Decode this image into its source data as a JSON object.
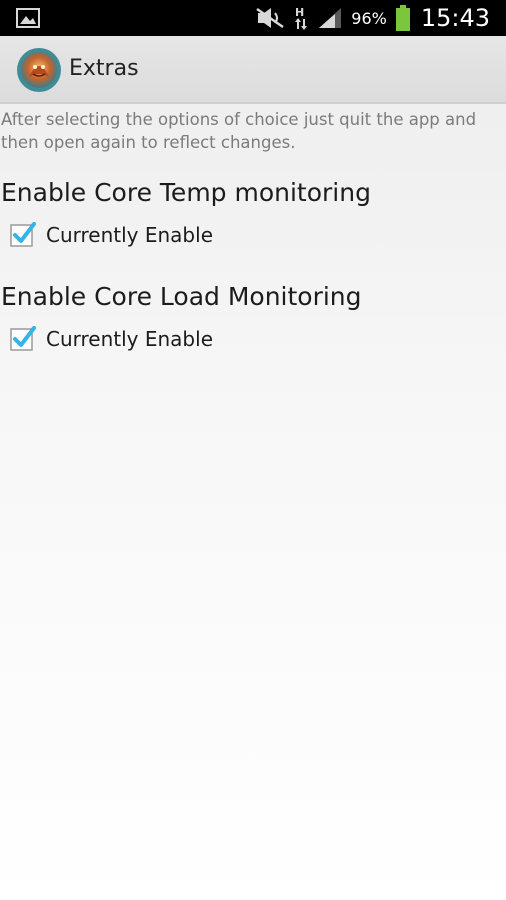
{
  "status_bar": {
    "battery_percent": "96%",
    "time": "15:43",
    "icons": [
      "image-notification-icon",
      "mute-icon",
      "network-hplus-icon",
      "signal-icon",
      "battery-icon"
    ]
  },
  "action_bar": {
    "title": "Extras",
    "icon": "app-logo-icon"
  },
  "content": {
    "instruction": "After selecting the options of choice just quit the app and then open again to reflect changes.",
    "sections": [
      {
        "title": "Enable Core Temp monitoring",
        "checkbox_label": "Currently Enable",
        "checked": true
      },
      {
        "title": "Enable Core Load Monitoring",
        "checkbox_label": "Currently Enable",
        "checked": true
      }
    ]
  },
  "colors": {
    "check_accent": "#33b5e5",
    "battery_green": "#7bc63a"
  }
}
